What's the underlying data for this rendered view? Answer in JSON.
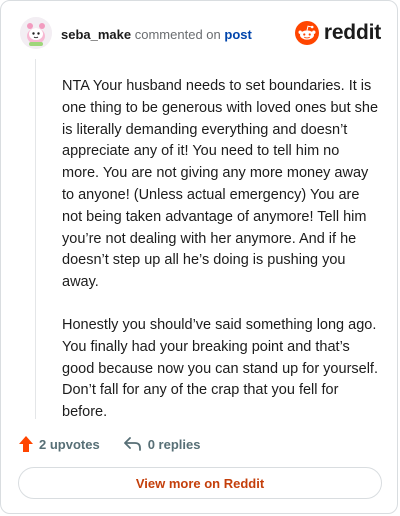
{
  "comment": {
    "username": "seba_make",
    "action_text": "commented on",
    "post_link": "post",
    "brand": "reddit",
    "paragraphs": [
      "NTA Your husband needs to set boundaries. It is one thing to be generous with loved ones but she is literally demanding everything and doesn’t appreciate any of it! You need to tell him no more. You are not giving any more money away to anyone! (Unless actual emergency) You are not being taken advantage of anymore! Tell him you’re not dealing with her anymore. And if he doesn’t step up all he’s doing is pushing you away.",
      "Honestly you should’ve said something long ago. You finally had your breaking point and that’s good because now you can stand up for yourself. Don’t fall for any of the crap that you fell for before."
    ]
  },
  "actions": {
    "upvotes": "2 upvotes",
    "replies": "0 replies"
  },
  "footer": {
    "view_more": "View more on Reddit"
  },
  "colors": {
    "brand_orange": "#ff4500",
    "link_blue": "#0045ac",
    "cta_text": "#c43f0b"
  },
  "icons": {
    "avatar": "snoo-avatar",
    "brand": "reddit-logo-icon",
    "upvote": "upvote-arrow-icon",
    "reply": "reply-arrow-icon"
  }
}
